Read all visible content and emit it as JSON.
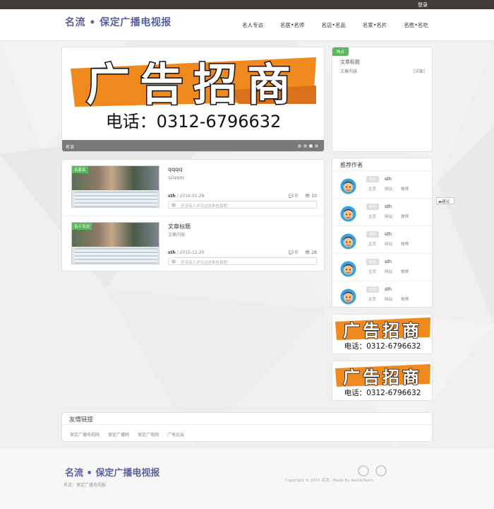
{
  "topbar": {
    "login": "登录"
  },
  "header": {
    "logo": "名流 • 保定广播电视报",
    "nav": [
      "名人专访",
      "名医•名师",
      "名店•名品",
      "名家•名片",
      "名胜•名吃"
    ]
  },
  "slider": {
    "ad_text": "广告招商",
    "ad_phone": "电话：0312-6796632",
    "caption": "名流",
    "dots": 4
  },
  "hot": {
    "tag": "热点",
    "title": "文章标题",
    "content": "文章内容",
    "more": "[详细]"
  },
  "posts": [
    {
      "badge": "名家名",
      "title": "qqqq",
      "desc": "q2qqqq",
      "author": "sth",
      "date": " / 2016-01-28",
      "comments": "0",
      "views": "10",
      "comment_placeholder": "还没有人评论过这条信息呢!"
    },
    {
      "badge": "名人专访",
      "title": "文章标题",
      "desc": "文章内容",
      "author": "sth",
      "date": " / 2015-12-20",
      "comments": "0",
      "views": "28",
      "comment_placeholder": "还没有人评论过这条信息呢!"
    }
  ],
  "authors": {
    "heading": "推荐作者",
    "items": [
      {
        "level": "级别",
        "name": "sth",
        "links": [
          "主页",
          "网站",
          "微博"
        ]
      },
      {
        "level": "级别",
        "name": "sth",
        "links": [
          "主页",
          "网站",
          "微博"
        ]
      },
      {
        "level": "级别",
        "name": "sth",
        "links": [
          "主页",
          "网站",
          "微博"
        ]
      },
      {
        "level": "级别",
        "name": "sth",
        "links": [
          "主页",
          "网站",
          "微博"
        ]
      },
      {
        "level": "级别",
        "name": "sth",
        "links": [
          "主页",
          "网站",
          "微博"
        ]
      }
    ]
  },
  "side_ads": [
    {
      "text": "广告招商",
      "phone": "电话：0312-6796632"
    },
    {
      "text": "广告招商",
      "phone": "电话：0312-6796632"
    }
  ],
  "feedback": "建议",
  "friends": {
    "heading": "友情链接",
    "links": [
      "保定广播电视网",
      "保定广播网",
      "保定广电网",
      "广电论坛"
    ]
  },
  "footer": {
    "logo": "名流 • 保定广播电视报",
    "sub": "名流：保定广播电视报",
    "copyright": "Copyright © 2015 名流 . Made By ApolloTeam"
  },
  "colors": {
    "accent": "#5d60a0",
    "green": "#5cb85c",
    "orange": "#f08a1e",
    "topbar": "#403c38"
  }
}
